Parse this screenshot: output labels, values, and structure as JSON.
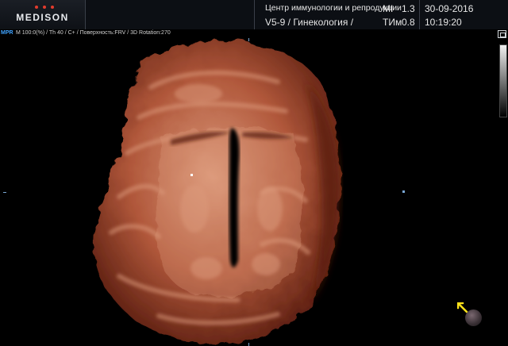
{
  "header": {
    "logo_text": "MEDISON",
    "logo_dot_colors": [
      "#e33b2d",
      "#e33b2d",
      "#e33b2d"
    ],
    "institution": "Центр иммунологии и репродукции",
    "probe_preset": "V5-9 / Гинекология /",
    "mi_label": "MI",
    "mi_value": "1.3",
    "tib_label": "TИм",
    "tib_value": "0.8",
    "date": "30-09-2016",
    "time": "10:19:20"
  },
  "status_bar": {
    "mode": "MPR",
    "info": "M 100:0(%) / Th 40 / C+ / Поверхность:FRV / 3D Rotation:270"
  },
  "viewport": {
    "image_name": "3d-uterus-rendering",
    "colors": {
      "tissue_main": "#b0573a",
      "tissue_light": "#dc9a7c",
      "tissue_dark": "#5a1d10",
      "background": "#000000",
      "accent_blue": "#3fa3ff",
      "orient_arrow": "#ffe21a"
    }
  }
}
